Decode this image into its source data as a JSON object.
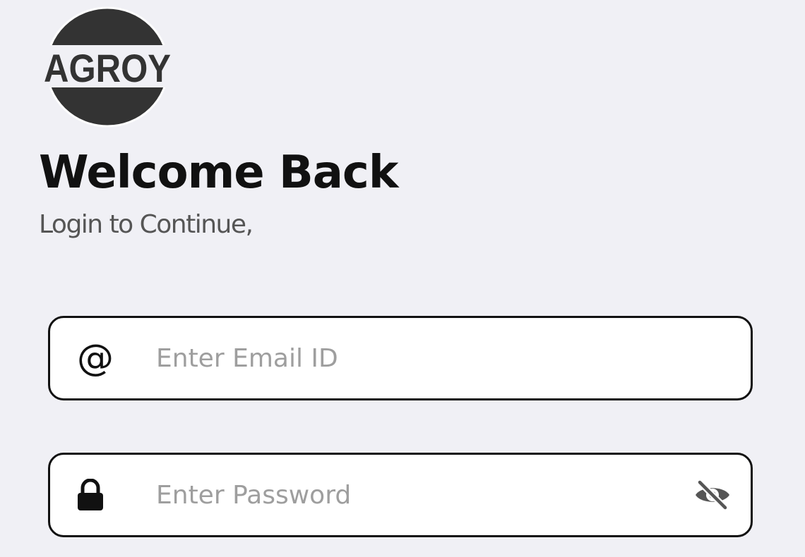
{
  "brand": {
    "logo_text": "AGROY",
    "logo_icon": "agroy-logo-icon",
    "logo_color": "#333333"
  },
  "header": {
    "title": "Welcome Back",
    "subtitle": "Login to Continue,"
  },
  "form": {
    "email": {
      "icon": "at-sign-icon",
      "icon_glyph": "@",
      "value": "",
      "placeholder": "Enter Email ID"
    },
    "password": {
      "icon": "lock-icon",
      "value": "",
      "placeholder": "Enter Password",
      "visibility_icon": "eye-off-icon"
    }
  },
  "colors": {
    "background": "#f0f0f5",
    "field_border": "#111111",
    "placeholder": "#9e9e9e",
    "title": "#111111",
    "subtitle": "#555555"
  }
}
